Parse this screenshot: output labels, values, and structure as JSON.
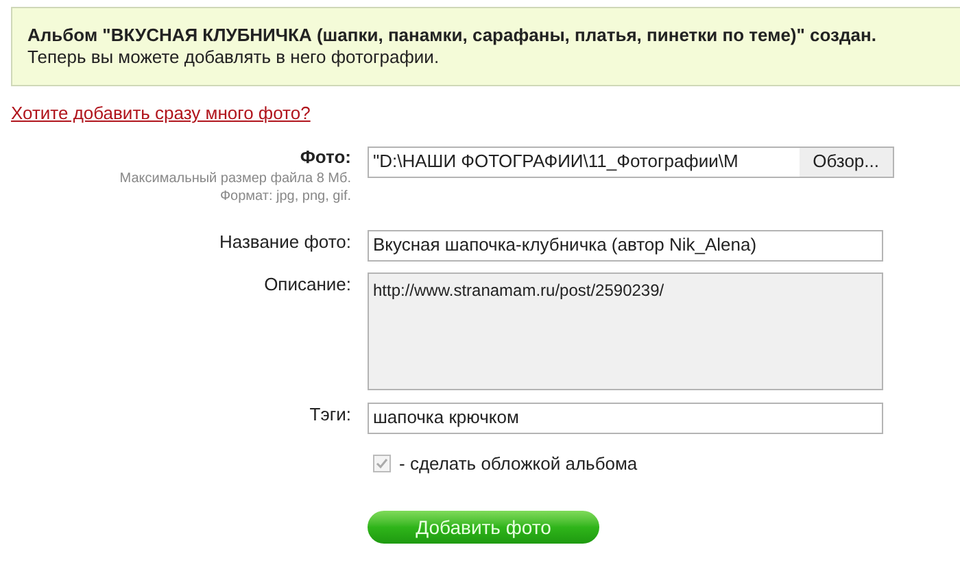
{
  "notice": {
    "title": "Альбом \"ВКУСНАЯ КЛУБНИЧКА (шапки, панамки, сарафаны, платья, пинетки по теме)\" создан.",
    "text": "Теперь вы можете добавлять в него фотографии."
  },
  "bulk_link": "Хотите добавить сразу много фото?",
  "form": {
    "photo": {
      "label": "Фото:",
      "hint_size": "Максимальный размер файла 8 Мб.",
      "hint_format": "Формат: jpg, png, gif.",
      "value": "\"D:\\НАШИ ФОТОГРАФИИ\\11_Фотографии\\M",
      "browse": "Обзор..."
    },
    "fields": [
      {
        "kind": "input",
        "label": "Название фото:",
        "value": "Вкусная шапочка-клубничка (автор Nik_Alena)"
      },
      {
        "kind": "textarea",
        "label": "Описание:",
        "value": "http://www.stranamam.ru/post/2590239/"
      },
      {
        "kind": "input",
        "label": "Тэги:",
        "value": "шапочка крючком"
      }
    ],
    "cover": {
      "label": "- сделать обложкой альбома",
      "checked": true,
      "disabled": true
    },
    "submit": "Добавить фото"
  }
}
